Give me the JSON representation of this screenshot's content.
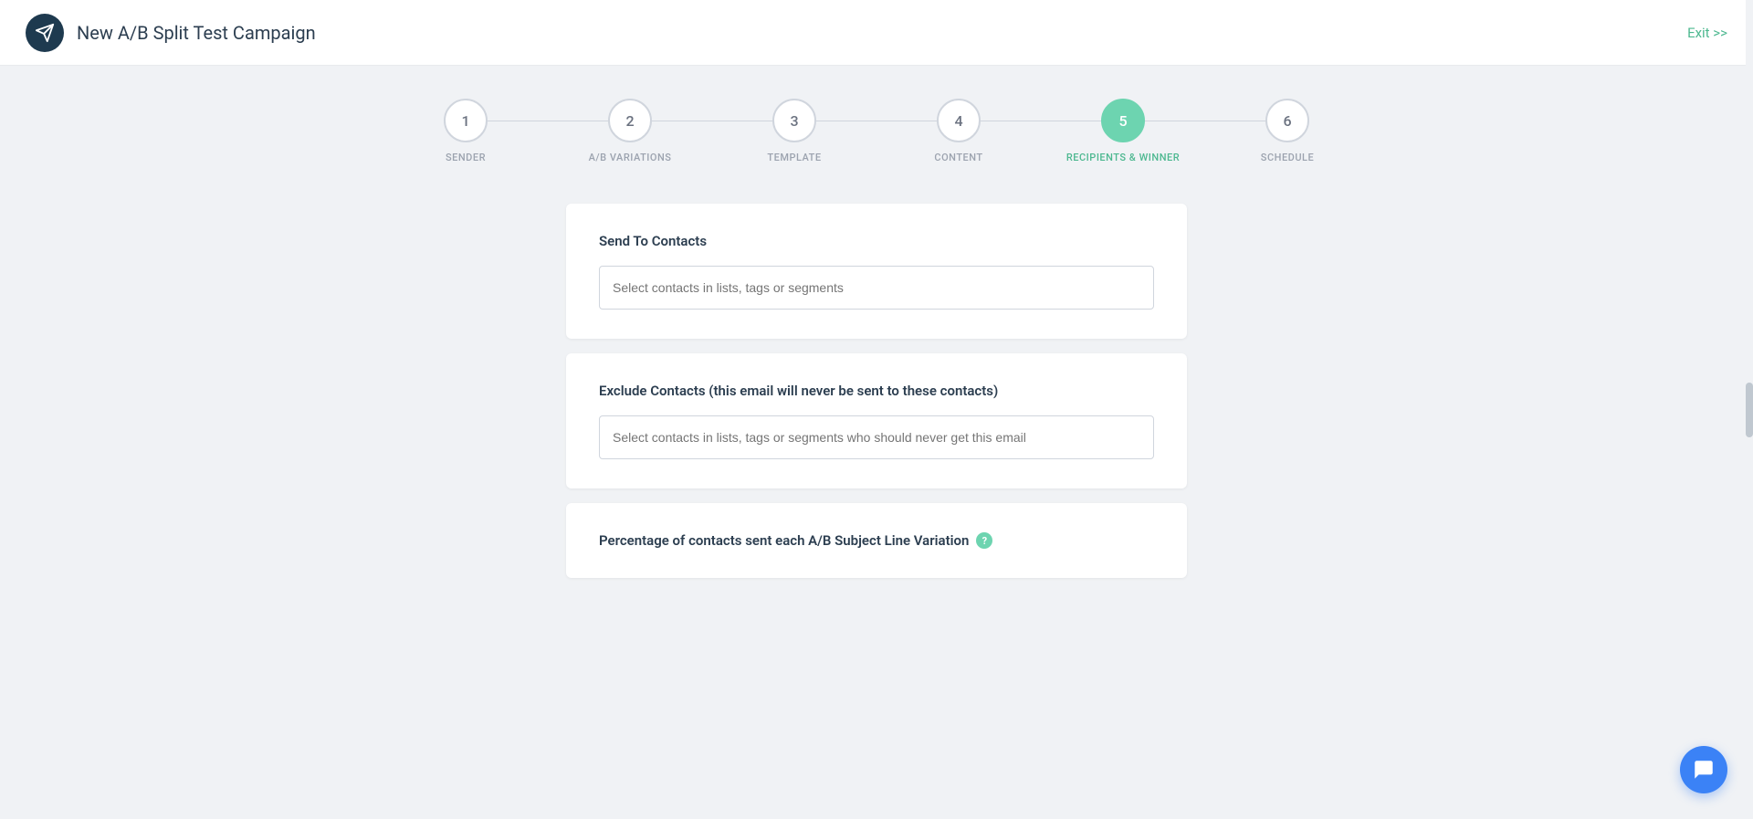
{
  "header": {
    "title": "New A/B Split Test Campaign",
    "exit_label": "Exit >>"
  },
  "steps": [
    {
      "number": "1",
      "label": "SENDER",
      "active": false
    },
    {
      "number": "2",
      "label": "A/B VARIATIONS",
      "active": false
    },
    {
      "number": "3",
      "label": "TEMPLATE",
      "active": false
    },
    {
      "number": "4",
      "label": "CONTENT",
      "active": false
    },
    {
      "number": "5",
      "label": "RECIPIENTS & WINNER",
      "active": true
    },
    {
      "number": "6",
      "label": "SCHEDULE",
      "active": false
    }
  ],
  "send_to_contacts": {
    "label": "Send To Contacts",
    "placeholder": "Select contacts in lists, tags or segments"
  },
  "exclude_contacts": {
    "label": "Exclude Contacts (this email will never be sent to these contacts)",
    "placeholder": "Select contacts in lists, tags or segments who should never get this email"
  },
  "percentage_section": {
    "label": "Percentage of contacts sent each A/B Subject Line Variation"
  },
  "colors": {
    "active_step": "#6dd4b0",
    "exit_link": "#4db890",
    "header_bg": "#1e3a4f",
    "chat_button": "#3b82f6"
  }
}
